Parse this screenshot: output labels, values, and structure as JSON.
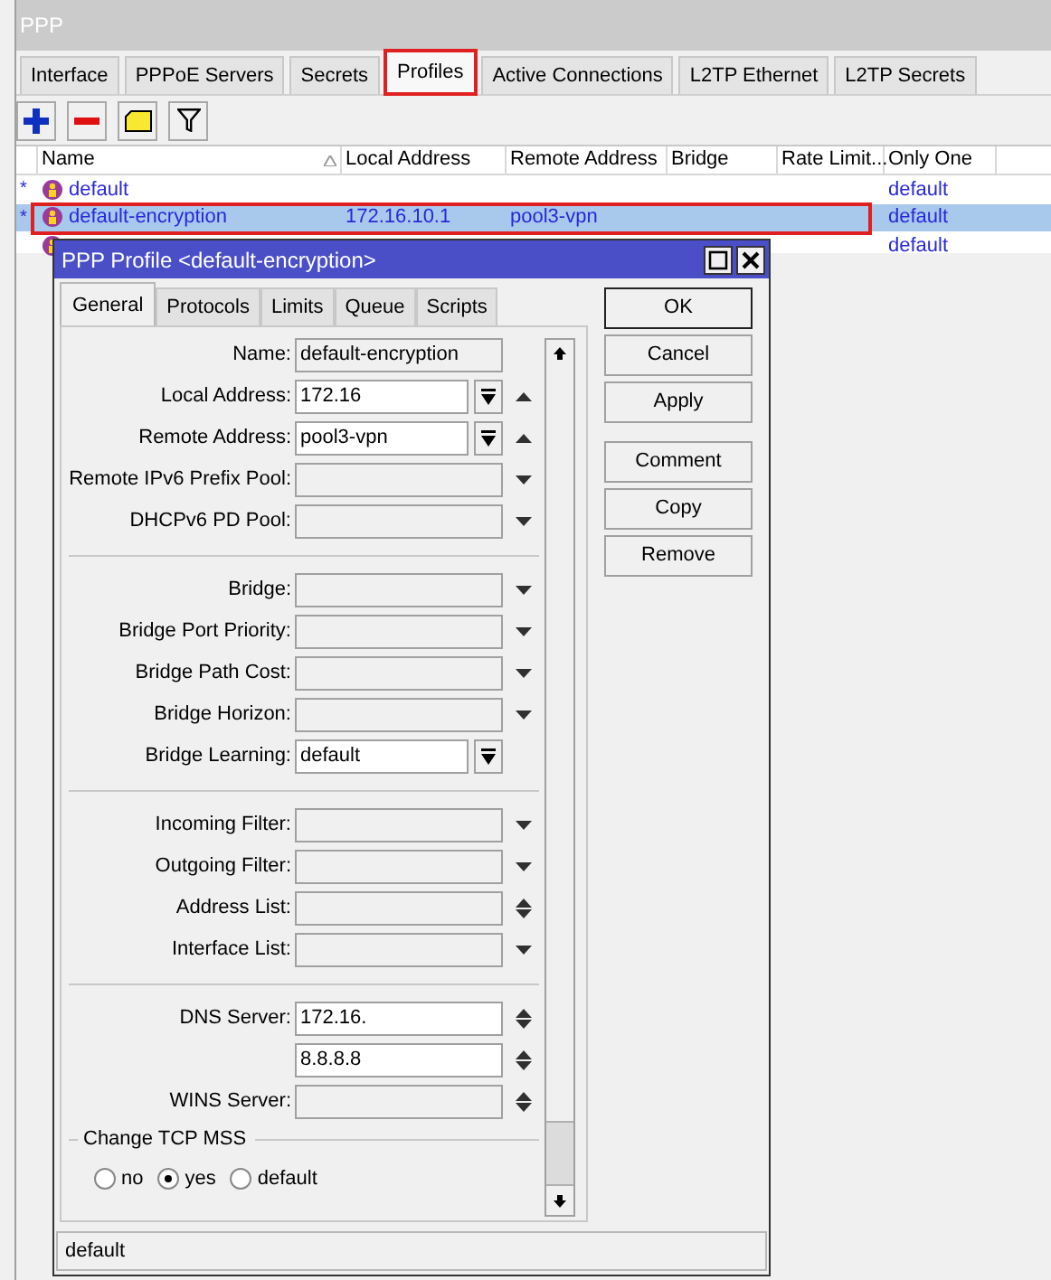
{
  "window": {
    "title": "PPP"
  },
  "tabs": [
    {
      "label": "Interface",
      "selected": false,
      "annotated": false
    },
    {
      "label": "PPPoE Servers",
      "selected": false,
      "annotated": false
    },
    {
      "label": "Secrets",
      "selected": false,
      "annotated": false
    },
    {
      "label": "Profiles",
      "selected": true,
      "annotated": true
    },
    {
      "label": "Active Connections",
      "selected": false,
      "annotated": false
    },
    {
      "label": "L2TP Ethernet",
      "selected": false,
      "annotated": false
    },
    {
      "label": "L2TP Secrets",
      "selected": false,
      "annotated": false
    }
  ],
  "toolbar": [
    {
      "kind": "add"
    },
    {
      "kind": "remove"
    },
    {
      "kind": "comment"
    },
    {
      "kind": "filter"
    }
  ],
  "table": {
    "columns": [
      {
        "label": "Name",
        "sorted": true
      },
      {
        "label": "Local Address",
        "sorted": false
      },
      {
        "label": "Remote Address",
        "sorted": false
      },
      {
        "label": "Bridge",
        "sorted": false
      },
      {
        "label": "Rate Limit...",
        "sorted": false
      },
      {
        "label": "Only One",
        "sorted": false
      }
    ],
    "rows": [
      {
        "marker": "*",
        "cells": [
          "default",
          null,
          null,
          null,
          null,
          "default"
        ],
        "selected": false,
        "annotated": false
      },
      {
        "marker": "*",
        "cells": [
          "default-encryption",
          "172.16.10.1",
          "pool3-vpn",
          null,
          null,
          "default"
        ],
        "selected": true,
        "annotated": true
      },
      {
        "cells": [
          null,
          null,
          null,
          null,
          null,
          "default"
        ],
        "selected": false,
        "annotated": false
      }
    ]
  },
  "dialog": {
    "title": "PPP Profile <default-encryption>",
    "tabs": [
      {
        "label": "General",
        "selected": true
      },
      {
        "label": "Protocols",
        "selected": false
      },
      {
        "label": "Limits",
        "selected": false
      },
      {
        "label": "Queue",
        "selected": false
      },
      {
        "label": "Scripts",
        "selected": false
      }
    ],
    "fields": [
      {
        "kind": "field",
        "label": "Name:",
        "value": "default-encryption",
        "editable": false,
        "dropdown_button": false,
        "up_arrow": false,
        "down_arrow": false
      },
      {
        "kind": "field",
        "label": "Local Address:",
        "value": "172.16",
        "editable": true,
        "dropdown_button": true,
        "up_arrow": true,
        "down_arrow": false
      },
      {
        "kind": "field",
        "label": "Remote Address:",
        "value": "pool3-vpn",
        "editable": true,
        "dropdown_button": true,
        "up_arrow": true,
        "down_arrow": false
      },
      {
        "kind": "field",
        "label": "Remote IPv6 Prefix Pool:",
        "editable": false,
        "dropdown_button": false,
        "up_arrow": false,
        "down_arrow": true
      },
      {
        "kind": "field",
        "label": "DHCPv6 PD Pool:",
        "editable": false,
        "dropdown_button": false,
        "up_arrow": false,
        "down_arrow": true
      },
      {
        "kind": "separator"
      },
      {
        "kind": "field",
        "label": "Bridge:",
        "editable": false,
        "dropdown_button": false,
        "up_arrow": false,
        "down_arrow": true
      },
      {
        "kind": "field",
        "label": "Bridge Port Priority:",
        "editable": false,
        "dropdown_button": false,
        "up_arrow": false,
        "down_arrow": true
      },
      {
        "kind": "field",
        "label": "Bridge Path Cost:",
        "editable": false,
        "dropdown_button": false,
        "up_arrow": false,
        "down_arrow": true
      },
      {
        "kind": "field",
        "label": "Bridge Horizon:",
        "editable": false,
        "dropdown_button": false,
        "up_arrow": false,
        "down_arrow": true
      },
      {
        "kind": "field",
        "label": "Bridge Learning:",
        "value": "default",
        "editable": true,
        "dropdown_button": true,
        "up_arrow": false,
        "down_arrow": false
      },
      {
        "kind": "separator"
      },
      {
        "kind": "field",
        "label": "Incoming Filter:",
        "editable": false,
        "dropdown_button": false,
        "up_arrow": false,
        "down_arrow": true
      },
      {
        "kind": "field",
        "label": "Outgoing Filter:",
        "editable": false,
        "dropdown_button": false,
        "up_arrow": false,
        "down_arrow": true
      },
      {
        "kind": "field",
        "label": "Address List:",
        "editable": false,
        "dropdown_button": false,
        "up_arrow": true,
        "down_arrow": true
      },
      {
        "kind": "field",
        "label": "Interface List:",
        "editable": false,
        "dropdown_button": false,
        "up_arrow": false,
        "down_arrow": true
      },
      {
        "kind": "separator"
      },
      {
        "kind": "field",
        "label": "DNS Server:",
        "value": "172.16.",
        "editable": true,
        "dropdown_button": false,
        "up_arrow": true,
        "down_arrow": true
      },
      {
        "kind": "field",
        "value": "8.8.8.8",
        "editable": true,
        "dropdown_button": false,
        "up_arrow": true,
        "down_arrow": true
      },
      {
        "kind": "field",
        "label": "WINS Server:",
        "editable": false,
        "dropdown_button": false,
        "up_arrow": true,
        "down_arrow": true
      },
      {
        "kind": "radio_group",
        "title": "Change TCP MSS",
        "options": [
          {
            "label": "no",
            "selected": false
          },
          {
            "label": "yes",
            "selected": true
          },
          {
            "label": "default",
            "selected": false
          }
        ]
      }
    ],
    "buttons": [
      [
        {
          "label": "OK",
          "default": true
        },
        {
          "label": "Cancel",
          "default": false
        },
        {
          "label": "Apply",
          "default": false
        }
      ],
      [
        {
          "label": "Comment",
          "default": false
        },
        {
          "label": "Copy",
          "default": false
        },
        {
          "label": "Remove",
          "default": false
        }
      ]
    ],
    "status": "default"
  }
}
